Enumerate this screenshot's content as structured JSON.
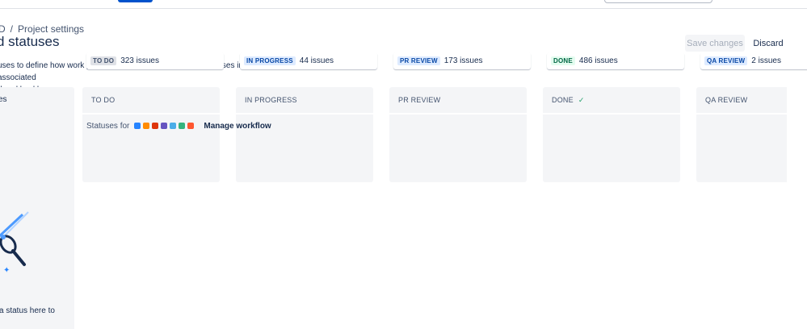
{
  "breadcrumb": {
    "items": [
      "D",
      "Project settings"
    ],
    "separator": "/"
  },
  "page": {
    "title": "d statuses"
  },
  "actions": {
    "save_label": "Save changes",
    "discard_label": "Discard"
  },
  "description": {
    "line1": "uses to define how work progresses on your board. Store statuses in the left panel to hide their associated",
    "line2": "d and backlog."
  },
  "left_panel": {
    "title": "es",
    "hint": "a status here to"
  },
  "statuses_row": {
    "label": "Statuses for",
    "manage_label": "Manage workflow"
  },
  "columns": [
    {
      "title": "TO DO",
      "lozenge": "TO DO",
      "count": "323 issues",
      "lozenge_color": "#dfe1e6"
    },
    {
      "title": "IN PROGRESS",
      "lozenge": "IN PROGRESS",
      "count": "44 issues",
      "lozenge_color": "#deebff"
    },
    {
      "title": "PR REVIEW",
      "lozenge": "PR REVIEW",
      "count": "173 issues",
      "lozenge_color": "#deebff"
    },
    {
      "title": "DONE",
      "lozenge": "DONE",
      "count": "486 issues",
      "lozenge_color": "#e3fcef",
      "check_icon": "check-icon"
    },
    {
      "title": "QA REVIEW",
      "lozenge": "QA REVIEW",
      "count": "2 issues",
      "lozenge_color": "#deebff"
    }
  ],
  "issue_type_icons": [
    {
      "name": "story-icon",
      "color": "#2684ff"
    },
    {
      "name": "task-icon",
      "color": "#ff8b00"
    },
    {
      "name": "bug-icon",
      "color": "#de350b"
    },
    {
      "name": "epic-icon",
      "color": "#6554c0"
    },
    {
      "name": "subtask-icon",
      "color": "#4bade8"
    },
    {
      "name": "improvement-icon",
      "color": "#36b37e"
    },
    {
      "name": "new-feature-icon",
      "color": "#ff5630"
    }
  ],
  "colors": {
    "accent": "#0052cc",
    "panel": "#f4f5f7",
    "text": "#172b4d"
  }
}
